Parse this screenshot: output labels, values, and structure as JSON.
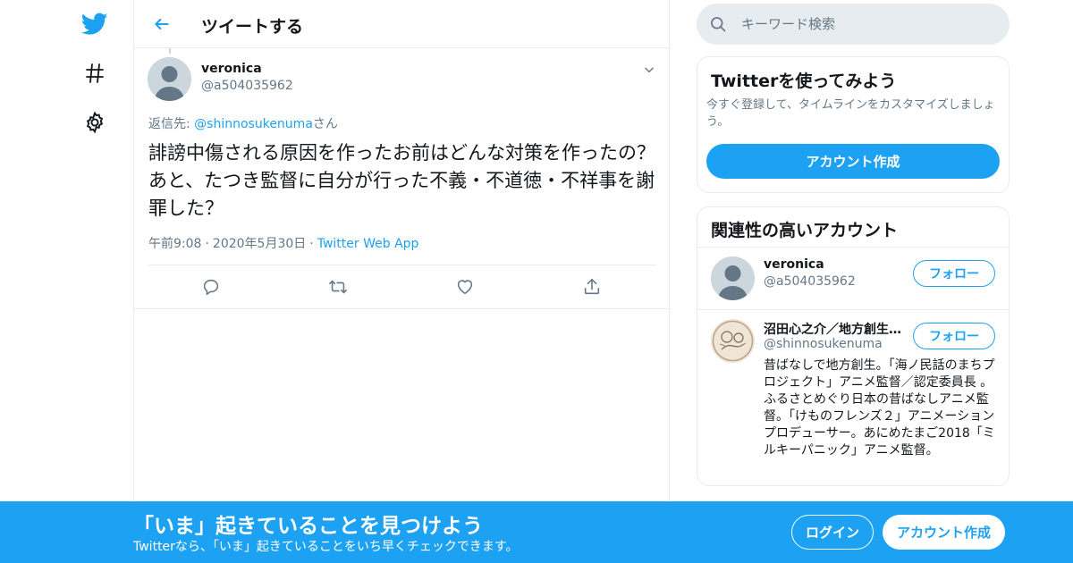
{
  "colors": {
    "brand": "#1da1f2",
    "text": "#14171a",
    "muted": "#657786",
    "border": "#e6ecf0"
  },
  "nav": {
    "items": [
      {
        "icon": "twitter-bird-icon"
      },
      {
        "icon": "hashtag-icon"
      },
      {
        "icon": "gear-icon"
      }
    ]
  },
  "header": {
    "title": "ツイートする",
    "back_icon": "arrow-left-icon"
  },
  "tweet": {
    "author_name": "veronica",
    "author_handle": "@a504035962",
    "reply_prefix": "返信先: ",
    "reply_mention": "@shinnosukenuma",
    "reply_suffix": "さん",
    "text": "誹謗中傷される原因を作ったお前はどんな対策を作ったの？あと、たつき監督に自分が行った不義・不道徳・不祥事を謝罪した？",
    "time": "午前9:08",
    "date": "2020年5月30日",
    "source": "Twitter Web App",
    "separator": "·",
    "actions": [
      "reply-icon",
      "retweet-icon",
      "like-icon",
      "share-icon"
    ]
  },
  "search": {
    "placeholder": "キーワード検索"
  },
  "signup_card": {
    "title": "Twitterを使ってみよう",
    "subtitle": "今すぐ登録して、タイムラインをカスタマイズしましょう。",
    "button": "アカウント作成"
  },
  "related": {
    "title": "関連性の高いアカウント",
    "accounts": [
      {
        "name": "veronica",
        "handle": "@a504035962",
        "follow": "フォロー"
      },
      {
        "name": "沼田心之介／地方創生アニメ監督",
        "handle": "@shinnosukenuma",
        "follow": "フォロー",
        "bio": "昔ばなしで地方創生。「海ノ民話のまちプロジェクト」アニメ監督／認定委員長 。ふるさとめぐり日本の昔ばなしアニメ監督。「けものフレンズ２」アニメーションプロデューサー。あにめたまご2018「ミルキーパニック」アニメ監督。"
      }
    ]
  },
  "banner": {
    "title": "「いま」起きていることを見つけよう",
    "subtitle": "Twitterなら、「いま」起きていることをいち早くチェックできます。",
    "login": "ログイン",
    "signup": "アカウント作成"
  }
}
